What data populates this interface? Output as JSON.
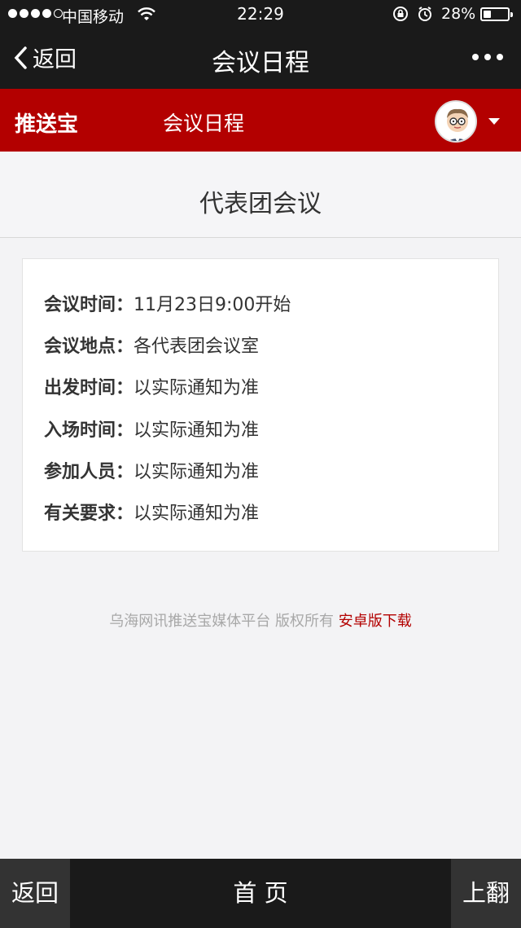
{
  "status_bar": {
    "carrier": "中国移动",
    "time": "22:29",
    "battery": "28%",
    "battery_level": 0.28
  },
  "nav": {
    "back_label": "返回",
    "title": "会议日程"
  },
  "header": {
    "brand": "推送宝",
    "subtitle": "会议日程",
    "accent_color": "#b30000"
  },
  "section": {
    "title": "代表团会议"
  },
  "details": [
    {
      "key": "会议时间：",
      "value": "11月23日9:00开始"
    },
    {
      "key": "会议地点：",
      "value": "各代表团会议室"
    },
    {
      "key": "出发时间：",
      "value": "以实际通知为准"
    },
    {
      "key": "入场时间：",
      "value": "以实际通知为准"
    },
    {
      "key": "参加人员：",
      "value": "以实际通知为准"
    },
    {
      "key": "有关要求：",
      "value": "以实际通知为准"
    }
  ],
  "footer": {
    "copyright": "乌海网讯推送宝媒体平台 版权所有 ",
    "download_link": "安卓版下载"
  },
  "bottom_bar": {
    "back": "返回",
    "home": "首 页",
    "page_up": "上翻"
  }
}
